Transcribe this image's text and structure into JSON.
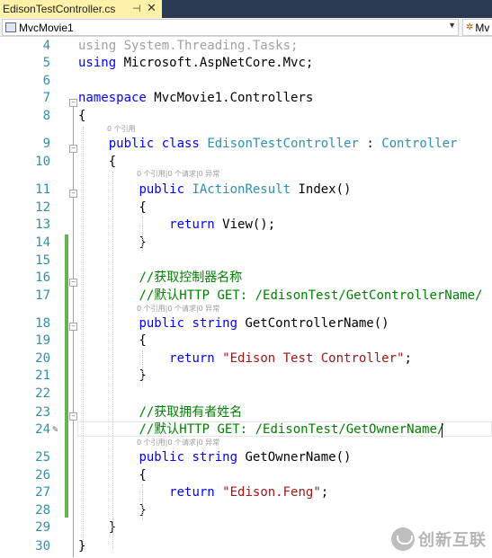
{
  "tab": {
    "title": "EdisonTestController.cs",
    "pin": "⊣",
    "close": "✕"
  },
  "navbar": {
    "project": "MvcMovie1",
    "member": "Mv"
  },
  "lens": {
    "refs0": "0 个引用",
    "refs_detail": "0 个引用|0 个请求|0 异常"
  },
  "code_lines": [
    {
      "n": "4",
      "tokens": [
        [
          "gr",
          "using System.Threading.Tasks;"
        ]
      ]
    },
    {
      "n": "5",
      "tokens": [
        [
          "kw",
          "using"
        ],
        [
          "",
          " Microsoft.AspNetCore.Mvc;"
        ]
      ]
    },
    {
      "n": "6",
      "tokens": []
    },
    {
      "n": "7",
      "tokens": [
        [
          "kw",
          "namespace"
        ],
        [
          "",
          " MvcMovie1.Controllers"
        ]
      ]
    },
    {
      "n": "8",
      "tokens": [
        [
          "",
          "{"
        ]
      ]
    },
    {
      "n": "9",
      "tokens": [
        [
          "",
          "    "
        ],
        [
          "kw",
          "public class"
        ],
        [
          "",
          " "
        ],
        [
          "ty",
          "EdisonTestController"
        ],
        [
          "",
          " : "
        ],
        [
          "ty",
          "Controller"
        ]
      ]
    },
    {
      "n": "10",
      "tokens": [
        [
          "",
          "    {"
        ]
      ]
    },
    {
      "n": "11",
      "tokens": [
        [
          "",
          "        "
        ],
        [
          "kw",
          "public"
        ],
        [
          "",
          " "
        ],
        [
          "ty",
          "IActionResult"
        ],
        [
          "",
          " Index()"
        ]
      ]
    },
    {
      "n": "12",
      "tokens": [
        [
          "",
          "        {"
        ]
      ]
    },
    {
      "n": "13",
      "tokens": [
        [
          "",
          "            "
        ],
        [
          "kw",
          "return"
        ],
        [
          "",
          " View();"
        ]
      ]
    },
    {
      "n": "14",
      "tokens": [
        [
          "",
          "        }"
        ]
      ]
    },
    {
      "n": "15",
      "tokens": []
    },
    {
      "n": "16",
      "tokens": [
        [
          "",
          "        "
        ],
        [
          "cm",
          "//获取控制器名称"
        ]
      ]
    },
    {
      "n": "17",
      "tokens": [
        [
          "",
          "        "
        ],
        [
          "cm",
          "//默认HTTP GET: /EdisonTest/GetControllerName/"
        ]
      ]
    },
    {
      "n": "18",
      "tokens": [
        [
          "",
          "        "
        ],
        [
          "kw",
          "public string"
        ],
        [
          "",
          " GetControllerName()"
        ]
      ]
    },
    {
      "n": "19",
      "tokens": [
        [
          "",
          "        {"
        ]
      ]
    },
    {
      "n": "20",
      "tokens": [
        [
          "",
          "            "
        ],
        [
          "kw",
          "return"
        ],
        [
          "",
          " "
        ],
        [
          "st",
          "\"Edison Test Controller\""
        ],
        [
          "",
          ";"
        ]
      ]
    },
    {
      "n": "21",
      "tokens": [
        [
          "",
          "        }"
        ]
      ]
    },
    {
      "n": "22",
      "tokens": []
    },
    {
      "n": "23",
      "tokens": [
        [
          "",
          "        "
        ],
        [
          "cm",
          "//获取拥有者姓名"
        ]
      ]
    },
    {
      "n": "24",
      "tokens": [
        [
          "",
          "        "
        ],
        [
          "cm",
          "//默认HTTP GET: /EdisonTest/GetOwnerName/"
        ]
      ]
    },
    {
      "n": "25",
      "tokens": [
        [
          "",
          "        "
        ],
        [
          "kw",
          "public string"
        ],
        [
          "",
          " GetOwnerName()"
        ]
      ]
    },
    {
      "n": "26",
      "tokens": [
        [
          "",
          "        {"
        ]
      ]
    },
    {
      "n": "27",
      "tokens": [
        [
          "",
          "            "
        ],
        [
          "kw",
          "return"
        ],
        [
          "",
          " "
        ],
        [
          "st",
          "\"Edison.Feng\""
        ],
        [
          "",
          ";"
        ]
      ]
    },
    {
      "n": "28",
      "tokens": [
        [
          "",
          "        }"
        ]
      ]
    },
    {
      "n": "29",
      "tokens": [
        [
          "",
          "    }"
        ]
      ]
    },
    {
      "n": "30",
      "tokens": [
        [
          "",
          "}"
        ]
      ]
    }
  ],
  "watermark": {
    "text": "创新互联"
  },
  "colors": {
    "keyword": "#0000ff",
    "type": "#2b91af",
    "comment": "#008000",
    "string": "#a31515",
    "changebar": "#62b455"
  }
}
